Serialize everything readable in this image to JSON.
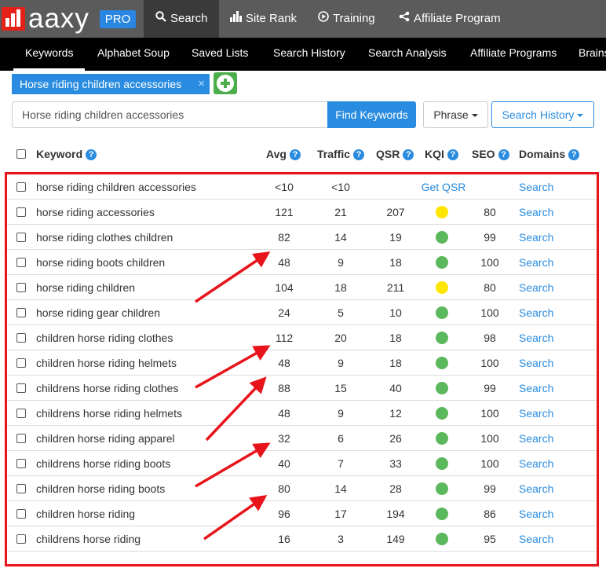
{
  "brand": {
    "logo_text": "aaxy",
    "pro_badge": "PRO"
  },
  "topnav": [
    {
      "label": "Search",
      "icon": "search-icon",
      "active": true
    },
    {
      "label": "Site Rank",
      "icon": "bar-chart-icon"
    },
    {
      "label": "Training",
      "icon": "play-circle-icon"
    },
    {
      "label": "Affiliate Program",
      "icon": "share-icon"
    }
  ],
  "subnav": [
    "Keywords",
    "Alphabet Soup",
    "Saved Lists",
    "Search History",
    "Search Analysis",
    "Affiliate Programs",
    "Brains"
  ],
  "chip": {
    "label": "Horse riding children accessories",
    "close": "×"
  },
  "search": {
    "value": "Horse riding children accessories",
    "find_label": "Find Keywords",
    "phrase_label": "Phrase",
    "history_label": "Search History"
  },
  "headers": {
    "keyword": "Keyword",
    "avg": "Avg",
    "traffic": "Traffic",
    "qsr": "QSR",
    "kqi": "KQI",
    "seo": "SEO",
    "domains": "Domains",
    "help": "?"
  },
  "colors": {
    "kqi_yellow": "#ffe600",
    "kqi_green": "#5cb85c",
    "accent": "#2a8ce0",
    "highlight": "#e8141b"
  },
  "rows": [
    {
      "keyword": "horse riding children accessories",
      "avg": "<10",
      "traffic": "<10",
      "qsr": "",
      "kqi": "",
      "seo": "",
      "qsr_link": "Get QSR",
      "domains": "Search"
    },
    {
      "keyword": "horse riding accessories",
      "avg": "121",
      "traffic": "21",
      "qsr": "207",
      "kqi": "yellow",
      "seo": "80",
      "domains": "Search"
    },
    {
      "keyword": "horse riding clothes children",
      "avg": "82",
      "traffic": "14",
      "qsr": "19",
      "kqi": "green",
      "seo": "99",
      "domains": "Search"
    },
    {
      "keyword": "horse riding boots children",
      "avg": "48",
      "traffic": "9",
      "qsr": "18",
      "kqi": "green",
      "seo": "100",
      "domains": "Search"
    },
    {
      "keyword": "horse riding children",
      "avg": "104",
      "traffic": "18",
      "qsr": "211",
      "kqi": "yellow",
      "seo": "80",
      "domains": "Search"
    },
    {
      "keyword": "horse riding gear children",
      "avg": "24",
      "traffic": "5",
      "qsr": "10",
      "kqi": "green",
      "seo": "100",
      "domains": "Search"
    },
    {
      "keyword": "children horse riding clothes",
      "avg": "112",
      "traffic": "20",
      "qsr": "18",
      "kqi": "green",
      "seo": "98",
      "domains": "Search"
    },
    {
      "keyword": "children horse riding helmets",
      "avg": "48",
      "traffic": "9",
      "qsr": "18",
      "kqi": "green",
      "seo": "100",
      "domains": "Search"
    },
    {
      "keyword": "childrens horse riding clothes",
      "avg": "88",
      "traffic": "15",
      "qsr": "40",
      "kqi": "green",
      "seo": "99",
      "domains": "Search"
    },
    {
      "keyword": "childrens horse riding helmets",
      "avg": "48",
      "traffic": "9",
      "qsr": "12",
      "kqi": "green",
      "seo": "100",
      "domains": "Search"
    },
    {
      "keyword": "children horse riding apparel",
      "avg": "32",
      "traffic": "6",
      "qsr": "26",
      "kqi": "green",
      "seo": "100",
      "domains": "Search"
    },
    {
      "keyword": "childrens horse riding boots",
      "avg": "40",
      "traffic": "7",
      "qsr": "33",
      "kqi": "green",
      "seo": "100",
      "domains": "Search"
    },
    {
      "keyword": "children horse riding boots",
      "avg": "80",
      "traffic": "14",
      "qsr": "28",
      "kqi": "green",
      "seo": "99",
      "domains": "Search"
    },
    {
      "keyword": "children horse riding",
      "avg": "96",
      "traffic": "17",
      "qsr": "194",
      "kqi": "green",
      "seo": "86",
      "domains": "Search"
    },
    {
      "keyword": "childrens horse riding",
      "avg": "16",
      "traffic": "3",
      "qsr": "149",
      "kqi": "green",
      "seo": "95",
      "domains": "Search"
    }
  ]
}
